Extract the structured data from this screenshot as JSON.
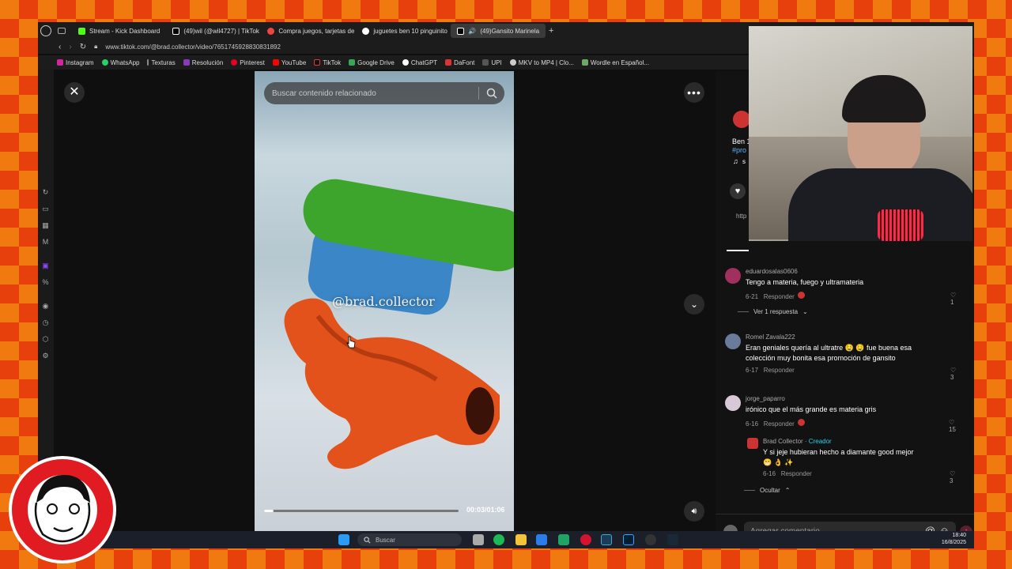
{
  "tabs": [
    {
      "label": "Stream - Kick Dashboard",
      "color": "#53fc18"
    },
    {
      "label": "(49)wil (@wil4727) | TikTok",
      "color": "#111"
    },
    {
      "label": "Compra juegos, tarjetas de",
      "color": "#e44"
    },
    {
      "label": "juguetes ben 10 pinguinito",
      "color": "#4285f4"
    },
    {
      "label": "(49)Gansito Marinela",
      "color": "#111"
    }
  ],
  "url": "www.tiktok.com/@brad.collector/video/7651745928830831892",
  "bookmarks": [
    {
      "label": "Instagram",
      "color": "#d6249f"
    },
    {
      "label": "WhatsApp",
      "color": "#25d366"
    },
    {
      "label": "Texturas",
      "color": "#888"
    },
    {
      "label": "Resolución",
      "color": "#8a3ab9"
    },
    {
      "label": "Pinterest",
      "color": "#e60023"
    },
    {
      "label": "YouTube",
      "color": "#ff0000"
    },
    {
      "label": "TikTok",
      "color": "#111"
    },
    {
      "label": "Google Drive",
      "color": "#34a853"
    },
    {
      "label": "ChatGPT",
      "color": "#10a37f"
    },
    {
      "label": "DaFont",
      "color": "#d33"
    },
    {
      "label": "UPI",
      "color": "#555"
    },
    {
      "label": "MKV to MP4 | Clo...",
      "color": "#999"
    },
    {
      "label": "Wordle en Español...",
      "color": "#6aaa64"
    }
  ],
  "video": {
    "search_placeholder": "Buscar contenido relacionado",
    "watermark": "@brad.collector",
    "timecode": "00:03/01:06",
    "progress": 0.05
  },
  "panel_top": {
    "title_fragment": "Ben 1",
    "hashtag_fragment": "#pro",
    "sound_fragment": "s",
    "link_fragment": "http"
  },
  "comments": [
    {
      "user": "eduardosalas0606",
      "text": "Tengo a materia, fuego y ultramateria",
      "date": "6-21",
      "reply": "Responder",
      "likes": "1",
      "avatar": "#a03060",
      "replies": "Ver 1 respuesta"
    },
    {
      "user": "Romel Zavala222",
      "text": "Eran geniales quería al ultratre 🤤 🤤 fue buena esa colección muy bonita esa promoción de gansito",
      "date": "6-17",
      "reply": "Responder",
      "likes": "3",
      "avatar": "#6a7a9a"
    },
    {
      "user": "jorge_paparro",
      "text": "irónico que el más grande es materia gris",
      "date": "6-16",
      "reply": "Responder",
      "likes": "15",
      "avatar": "#c8c8d8"
    }
  ],
  "creator_reply": {
    "user": "Brad Collector",
    "badge": "Creador",
    "text": "Y si jeje hubieran hecho a diamante good mejor😁 👌 ✨",
    "date": "6-16",
    "reply": "Responder",
    "likes": "3",
    "hide": "Ocultar"
  },
  "comment_input_placeholder": "Agregar comentario...",
  "taskbar": {
    "search": "Buscar",
    "time": "18:40",
    "date": "16/8/2025"
  }
}
